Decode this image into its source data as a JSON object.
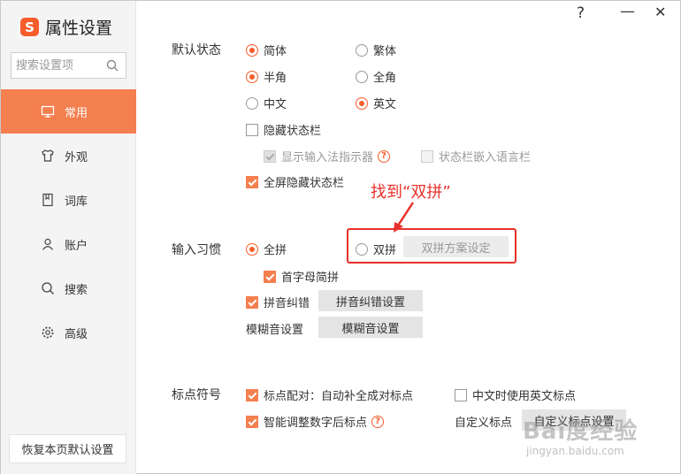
{
  "app": {
    "title": "属性设置",
    "logo_glyph": "S"
  },
  "window_controls": {
    "help": "?",
    "minimize": "—",
    "close": "✕"
  },
  "search": {
    "placeholder": "搜索设置项"
  },
  "nav": [
    {
      "label": "常用",
      "icon": "monitor-icon",
      "active": true
    },
    {
      "label": "外观",
      "icon": "shirt-icon",
      "active": false
    },
    {
      "label": "词库",
      "icon": "book-icon",
      "active": false
    },
    {
      "label": "账户",
      "icon": "user-icon",
      "active": false
    },
    {
      "label": "搜索",
      "icon": "search-icon",
      "active": false
    },
    {
      "label": "高级",
      "icon": "gear-icon",
      "active": false
    }
  ],
  "reset_label": "恢复本页默认设置",
  "default_state": {
    "label": "默认状态",
    "simplified": "简体",
    "traditional": "繁体",
    "halfwidth": "半角",
    "fullwidth": "全角",
    "chinese": "中文",
    "english": "英文",
    "hide_statusbar": "隐藏状态栏",
    "show_indicator": "显示输入法指示器",
    "embed_langbar": "状态栏嵌入语言栏",
    "fullscreen_hide": "全屏隐藏状态栏"
  },
  "input_habit": {
    "label": "输入习惯",
    "quanpin": "全拼",
    "shuangpin": "双拼",
    "shuangpin_btn": "双拼方案设定",
    "initials": "首字母简拼",
    "correction": "拼音纠错",
    "correction_btn": "拼音纠错设置",
    "fuzzy_label": "模糊音设置",
    "fuzzy_btn": "模糊音设置"
  },
  "punctuation": {
    "label": "标点符号",
    "auto_pair": "标点配对：自动补全成对标点",
    "english_punct": "中文时使用英文标点",
    "smart_adjust": "智能调整数字后标点",
    "custom_label": "自定义标点",
    "custom_btn": "自定义标点设置"
  },
  "annotation": {
    "text": "找到“双拼”"
  },
  "watermark": {
    "text": "Bai度经验",
    "url": "jingyan.baidu.com"
  },
  "colors": {
    "accent": "#f65d2b",
    "nav_active": "#f47f4f",
    "annotation": "#e8302a"
  }
}
